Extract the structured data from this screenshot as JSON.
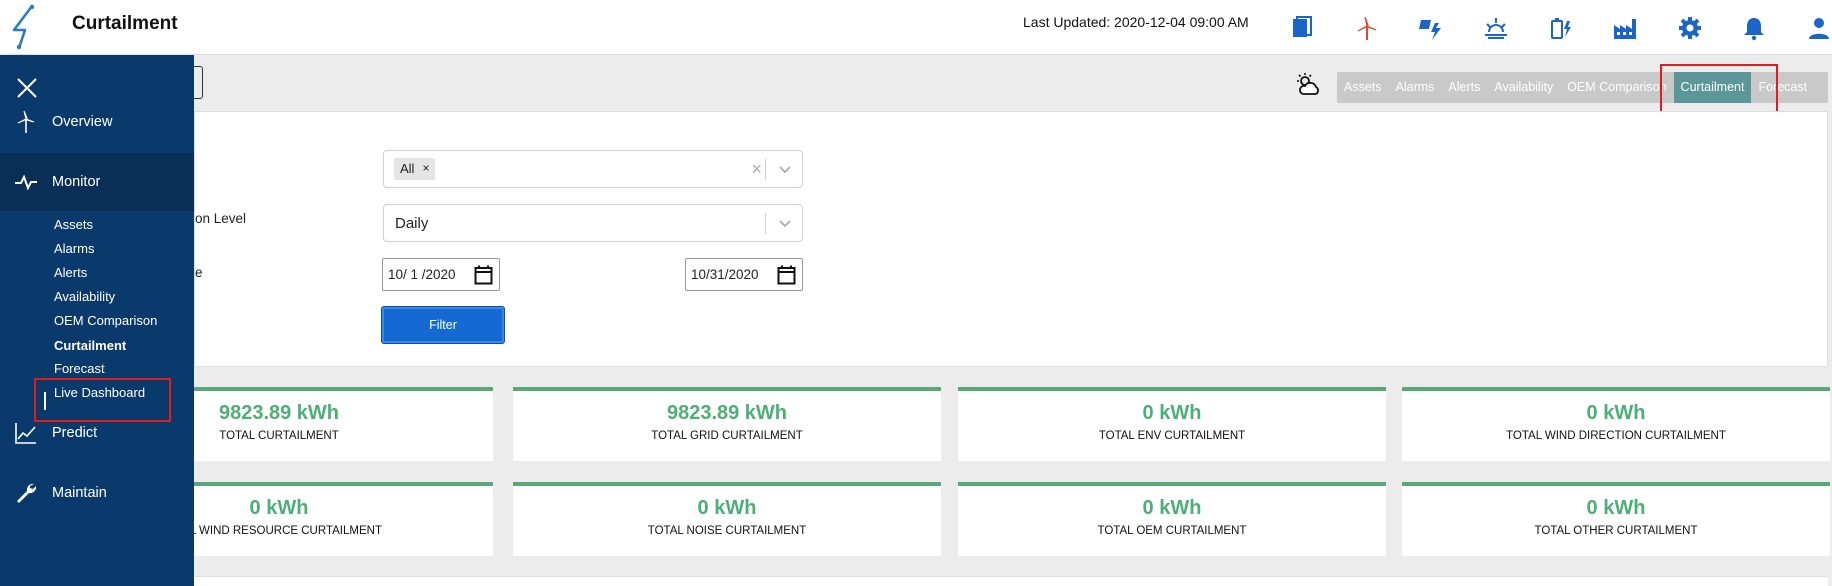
{
  "header": {
    "title": "Curtailment",
    "last_updated": "Last Updated: 2020-12-04 09:00 AM",
    "icons": [
      "document-icon",
      "wind-turbine-icon",
      "solar-power-icon",
      "sunset-icon",
      "battery-charging-icon",
      "factory-icon",
      "gear-icon",
      "bell-icon",
      "user-icon"
    ]
  },
  "sidebar": {
    "overview": "Overview",
    "monitor": "Monitor",
    "submenu": [
      "Assets",
      "Alarms",
      "Alerts",
      "Availability",
      "OEM Comparison",
      "Curtailment",
      "Forecast",
      "Live Dashboard"
    ],
    "active_subitem": "Curtailment",
    "predict": "Predict",
    "maintain": "Maintain"
  },
  "tabs": {
    "items": [
      "Assets",
      "Alarms",
      "Alerts",
      "Availability",
      "OEM Comparison",
      "Curtailment",
      "Forecast"
    ],
    "active": "Curtailment"
  },
  "filters": {
    "label_level": "on Level",
    "label_date": "e",
    "asset_chip": "All",
    "chip_remove": "×",
    "level_value": "Daily",
    "clear_symbol": "×",
    "start_date": "10/ 1 /2020",
    "end_date": "10/31/2020",
    "filter_button": "Filter"
  },
  "cards": [
    {
      "value": "9823.89 kWh",
      "caption": "TOTAL CURTAILMENT"
    },
    {
      "value": "9823.89 kWh",
      "caption": "TOTAL GRID CURTAILMENT"
    },
    {
      "value": "0 kWh",
      "caption": "TOTAL ENV CURTAILMENT"
    },
    {
      "value": "0 kWh",
      "caption": "TOTAL WIND DIRECTION CURTAILMENT"
    },
    {
      "value": "0 kWh",
      "caption": "TAL WIND RESOURCE CURTAILMENT"
    },
    {
      "value": "0 kWh",
      "caption": "TOTAL NOISE CURTAILMENT"
    },
    {
      "value": "0 kWh",
      "caption": "TOTAL OEM CURTAILMENT"
    },
    {
      "value": "0 kWh",
      "caption": "TOTAL OTHER CURTAILMENT"
    }
  ],
  "colors": {
    "sidebar": "#0a3a6b",
    "accent_blue": "#1469d3",
    "kpi_green": "#4caf76",
    "active_tab": "#5b9799",
    "highlight_red": "#e21b1b"
  }
}
